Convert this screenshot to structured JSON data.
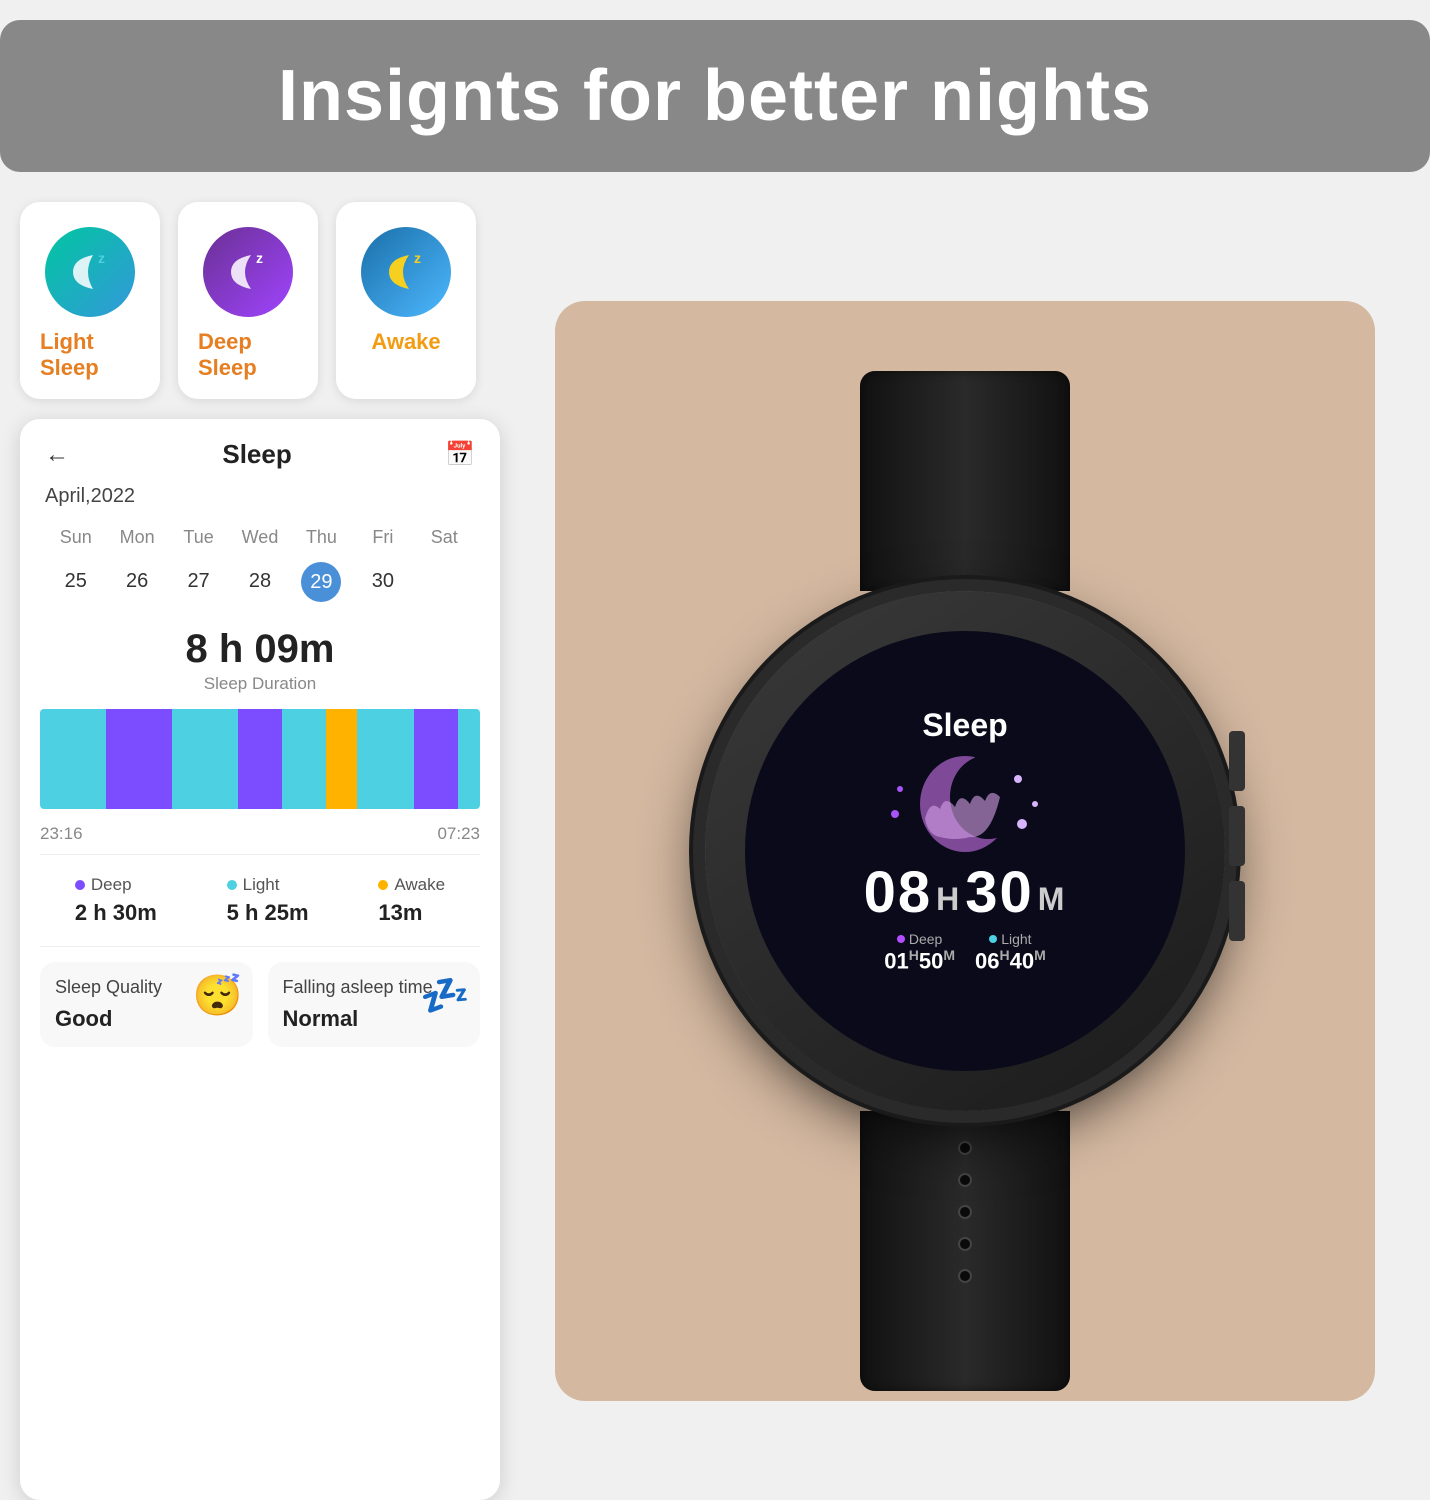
{
  "header": {
    "title": "Insignts for better nights",
    "background": "#888888"
  },
  "sleep_icons": [
    {
      "id": "light",
      "label": "Light Sleep",
      "icon": "🌙",
      "type": "light"
    },
    {
      "id": "deep",
      "label": "Deep Sleep",
      "icon": "🌙",
      "type": "deep"
    },
    {
      "id": "awake",
      "label": "Awake",
      "icon": "🌙",
      "type": "awake"
    }
  ],
  "app": {
    "title": "Sleep",
    "date": "April,2022",
    "calendar": {
      "day_names": [
        "Sun",
        "Mon",
        "Tue",
        "Wed",
        "Thu",
        "Fri",
        "Sat"
      ],
      "dates": [
        "25",
        "26",
        "27",
        "28",
        "29",
        "30"
      ],
      "selected": "29"
    },
    "sleep_duration": {
      "value": "8 h 09m",
      "label": "Sleep Duration"
    },
    "bar_times": {
      "start": "23:16",
      "end": "07:23"
    },
    "stats": [
      {
        "color": "#7c4dff",
        "label": "Deep",
        "value": "2 h 30m"
      },
      {
        "color": "#4dd0e1",
        "label": "Light",
        "value": "5 h 25m"
      },
      {
        "color": "#ffb300",
        "label": "Awake",
        "value": "13m"
      }
    ],
    "quality_cards": [
      {
        "title": "Sleep Quality",
        "value": "Good",
        "emoji": "😴"
      },
      {
        "title": "Falling asleep time",
        "value": "Normal",
        "emoji": "💤"
      }
    ]
  },
  "watch": {
    "sleep_label": "Sleep",
    "time": {
      "hours": "08",
      "h_unit": "H",
      "minutes": "30",
      "m_unit": "M"
    },
    "details": [
      {
        "dot_color": "#b44dff",
        "label": "Deep",
        "value": "01",
        "h": "H",
        "min": "50",
        "m": "M"
      },
      {
        "dot_color": "#4dd0e1",
        "label": "Light",
        "value": "06",
        "h": "H",
        "min": "40",
        "m": "M"
      }
    ]
  }
}
